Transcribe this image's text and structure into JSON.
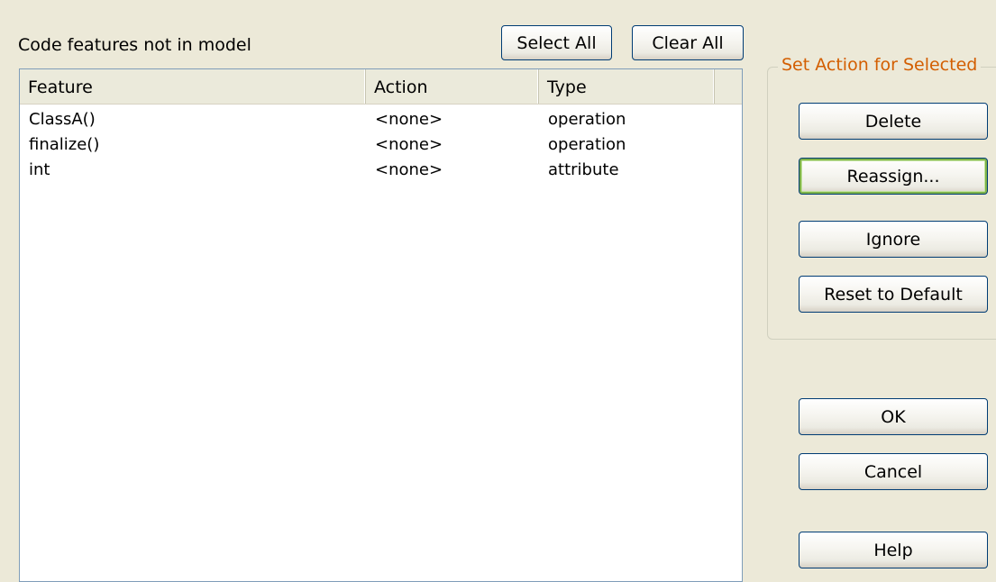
{
  "dialog": {
    "list_title": "Code features not in model",
    "select_all_label": "Select All",
    "clear_all_label": "Clear All"
  },
  "table": {
    "columns": [
      "Feature",
      "Action",
      "Type"
    ],
    "rows": [
      {
        "feature": "ClassA()",
        "action": "<none>",
        "type": "operation"
      },
      {
        "feature": "finalize()",
        "action": "<none>",
        "type": "operation"
      },
      {
        "feature": "int",
        "action": "<none>",
        "type": "attribute"
      }
    ]
  },
  "action_group": {
    "title": "Set Action for Selected",
    "delete_label": "Delete",
    "reassign_label": "Reassign...",
    "ignore_label": "Ignore",
    "reset_label": "Reset to Default"
  },
  "footer": {
    "ok_label": "OK",
    "cancel_label": "Cancel",
    "help_label": "Help"
  },
  "colors": {
    "dialog_background": "#ECE9D8",
    "group_title": "#D35E00",
    "button_border": "#003C74"
  }
}
